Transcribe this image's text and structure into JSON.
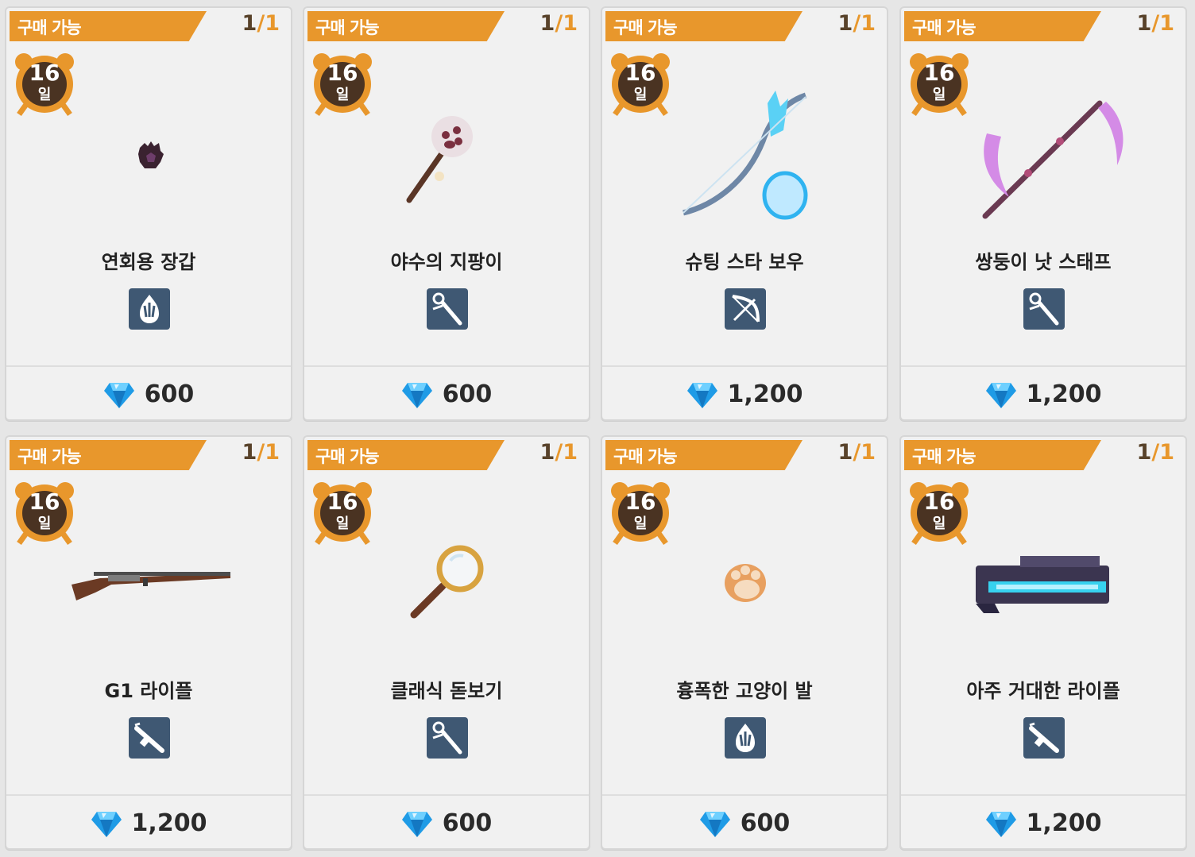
{
  "status_label": "구매 가능",
  "gem_icon": "blue-gem-icon",
  "colors": {
    "tag": "#e8972c",
    "type_icon_bg": "#3f5873",
    "clock": "#e8972c"
  },
  "items": [
    {
      "status": "구매 가능",
      "stock": "1",
      "stock_max": "1",
      "days": "16",
      "days_unit": "일",
      "name": "연회용 장갑",
      "category_icon": "claw-glove-icon",
      "price": "600",
      "art": "glove"
    },
    {
      "status": "구매 가능",
      "stock": "1",
      "stock_max": "1",
      "days": "16",
      "days_unit": "일",
      "name": "야수의 지팡이",
      "category_icon": "staff-icon",
      "price": "600",
      "art": "paw-staff"
    },
    {
      "status": "구매 가능",
      "stock": "1",
      "stock_max": "1",
      "days": "16",
      "days_unit": "일",
      "name": "슈팅 스타 보우",
      "category_icon": "bow-icon",
      "price": "1,200",
      "art": "bow"
    },
    {
      "status": "구매 가능",
      "stock": "1",
      "stock_max": "1",
      "days": "16",
      "days_unit": "일",
      "name": "쌍둥이 낫 스태프",
      "category_icon": "staff-icon",
      "price": "1,200",
      "art": "scythe"
    },
    {
      "status": "구매 가능",
      "stock": "1",
      "stock_max": "1",
      "days": "16",
      "days_unit": "일",
      "name": "G1 라이플",
      "category_icon": "rifle-icon",
      "price": "1,200",
      "art": "rifle"
    },
    {
      "status": "구매 가능",
      "stock": "1",
      "stock_max": "1",
      "days": "16",
      "days_unit": "일",
      "name": "클래식 돋보기",
      "category_icon": "staff-icon",
      "price": "600",
      "art": "magnifier"
    },
    {
      "status": "구매 가능",
      "stock": "1",
      "stock_max": "1",
      "days": "16",
      "days_unit": "일",
      "name": "흉폭한 고양이 발",
      "category_icon": "claw-glove-icon",
      "price": "600",
      "art": "cat-paw"
    },
    {
      "status": "구매 가능",
      "stock": "1",
      "stock_max": "1",
      "days": "16",
      "days_unit": "일",
      "name": "아주 거대한 라이플",
      "category_icon": "rifle-icon",
      "price": "1,200",
      "art": "big-gun"
    }
  ]
}
